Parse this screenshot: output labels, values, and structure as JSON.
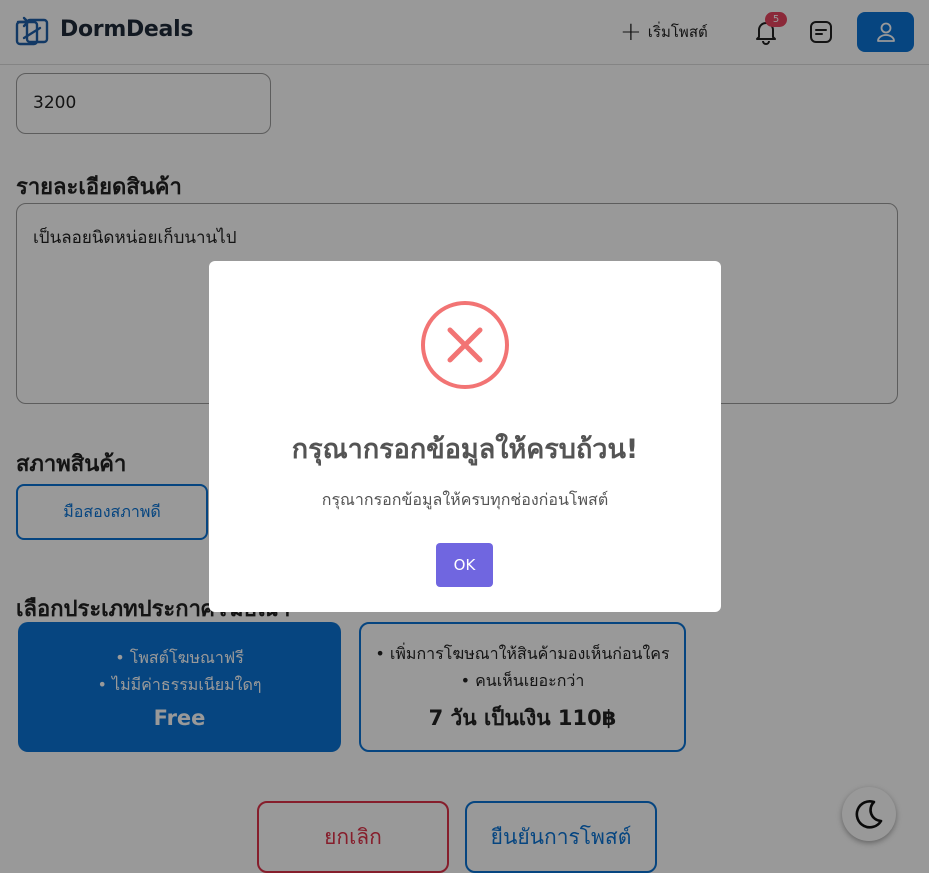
{
  "header": {
    "brand": "DormDeals",
    "new_post_label": "เริ่มโพสต์",
    "notification_count": "5",
    "colors": {
      "accent": "#0b74d6",
      "badge": "#e8455f"
    }
  },
  "form": {
    "price_value": "3200",
    "description_title": "รายละเอียดสินค้า",
    "description_value": "เป็นลอยนิดหน่อยเก็บนานไป",
    "condition_title": "สภาพสินค้า",
    "condition_option": "มือสองสภาพดี",
    "ad_type_title": "เลือกประเภทประกาศโฆษณา",
    "ad_free": {
      "line1": "• โพสต์โฆษณาฟรี",
      "line2": "• ไม่มีค่าธรรมเนียมใดๆ",
      "price": "Free"
    },
    "ad_paid": {
      "line1": "• เพิ่มการโฆษณาให้สินค้ามองเห็นก่อนใคร",
      "line2": "• คนเห็นเยอะกว่า",
      "price": "7 วัน เป็นเงิน 110฿"
    },
    "cancel_label": "ยกเลิก",
    "confirm_label": "ยืนยันการโพสต์"
  },
  "theme_toggle_icon": "moon-icon",
  "modal": {
    "icon": "error-x-icon",
    "title": "กรุณากรอกข้อมูลให้ครบถ้วน!",
    "text": "กรุณากรอกข้อมูลให้ครบทุกช่องก่อนโพสต์",
    "ok_label": "OK",
    "colors": {
      "error": "#f27474",
      "ok_button": "#7066e0"
    }
  }
}
